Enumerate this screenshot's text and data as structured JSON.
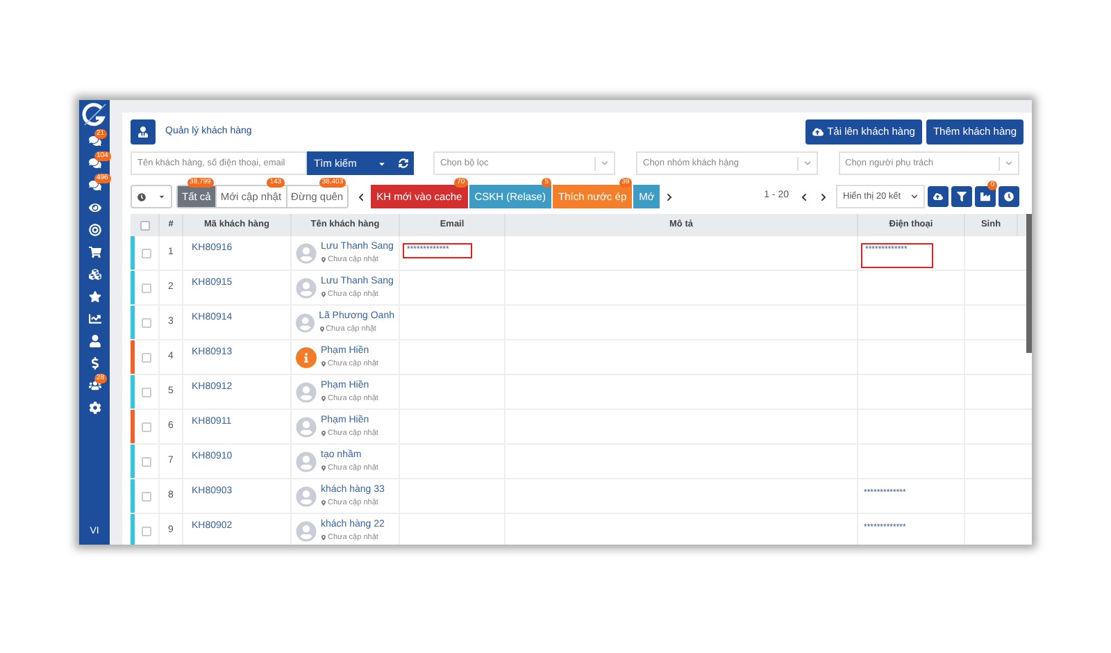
{
  "sidebar": {
    "items": [
      {
        "kind": "chat",
        "badge": "21"
      },
      {
        "kind": "chat",
        "badge": "104"
      },
      {
        "kind": "chat",
        "badge": "496"
      },
      {
        "kind": "eye"
      },
      {
        "kind": "target"
      },
      {
        "kind": "cart"
      },
      {
        "kind": "boxes"
      },
      {
        "kind": "star"
      },
      {
        "kind": "chart"
      },
      {
        "kind": "user"
      },
      {
        "kind": "dollar"
      },
      {
        "kind": "team",
        "badge": "28"
      },
      {
        "kind": "gear"
      }
    ],
    "language": "VI"
  },
  "header": {
    "title": "Quản lý khách hàng",
    "buttons": [
      "Tải lên khách hàng",
      "Thêm khách hàng"
    ]
  },
  "search": {
    "placeholder": "Tên khách hàng, số điện thoại, email",
    "button": "Tìm kiếm"
  },
  "selects": [
    {
      "placeholder": "Chọn bộ lọc"
    },
    {
      "placeholder": "Chọn nhóm khách hàng"
    },
    {
      "placeholder": "Chọn người phụ trách"
    }
  ],
  "filter_tabs": [
    {
      "label": "Tất cả",
      "badge": "38,799",
      "selected": true
    },
    {
      "label": "Mới cập nhật",
      "badge": "143",
      "selected": false
    },
    {
      "label": "Đừng quên",
      "badge": "38,403",
      "selected": false
    }
  ],
  "tags": [
    {
      "label": "KH mới vào cache",
      "badge": "70",
      "color": "#d42f2f"
    },
    {
      "label": "CSKH (Relase)",
      "badge": "5",
      "color": "#3e9bc4"
    },
    {
      "label": "Thích nước ép",
      "badge": "39",
      "color": "#f47f2a"
    },
    {
      "label": "Mớ",
      "color": "#3e9bc4"
    }
  ],
  "pagination": {
    "range": "1 - 20",
    "page_size": "Hiển thị 20 kết"
  },
  "toolbar": {
    "group_badge": "0"
  },
  "table": {
    "select_all_checked": false,
    "columns": [
      "#",
      "Mã khách hàng",
      "Tên khách hàng",
      "Email",
      "Mô tả",
      "Điện thoại",
      "Sinh"
    ],
    "rows": [
      {
        "color": "#35c6dc",
        "checked": false,
        "index": "1",
        "code": "KH80916",
        "name": "Lưu Thanh Sang",
        "location": "Chưa cập nhật",
        "kind": "person",
        "email": "*************",
        "email_highlighted": true,
        "phone": "*************",
        "phone_highlighted": true
      },
      {
        "color": "#35c6dc",
        "checked": false,
        "index": "2",
        "code": "KH80915",
        "name": "Lưu Thanh Sang",
        "location": "Chưa cập nhật",
        "kind": "person"
      },
      {
        "color": "#35c6dc",
        "checked": false,
        "index": "3",
        "code": "KH80914",
        "name": "Lã Phương Oanh",
        "location": "Chưa cập nhật",
        "kind": "person"
      },
      {
        "color": "#f0622a",
        "checked": false,
        "index": "4",
        "code": "KH80913",
        "name": "Phạm Hiền",
        "location": "Chưa cập nhật",
        "kind": "info"
      },
      {
        "color": "#35c6dc",
        "checked": false,
        "index": "5",
        "code": "KH80912",
        "name": "Phạm Hiền",
        "location": "Chưa cập nhật",
        "kind": "person"
      },
      {
        "color": "#f0622a",
        "checked": false,
        "index": "6",
        "code": "KH80911",
        "name": "Phạm Hiền",
        "location": "Chưa cập nhật",
        "kind": "person"
      },
      {
        "color": "#35c6dc",
        "checked": false,
        "index": "7",
        "code": "KH80910",
        "name": "tạo nhầm",
        "location": "Chưa cập nhật",
        "kind": "person"
      },
      {
        "color": "#35c6dc",
        "checked": false,
        "index": "8",
        "code": "KH80903",
        "name": "khách hàng 33",
        "location": "Chưa cập nhật",
        "kind": "person",
        "phone": "*************",
        "phone_highlighted": false
      },
      {
        "color": "#35c6dc",
        "checked": false,
        "index": "9",
        "code": "KH80902",
        "name": "khách hàng 22",
        "location": "Chưa cập nhật",
        "kind": "person",
        "phone": "*************",
        "phone_highlighted": false
      }
    ]
  }
}
